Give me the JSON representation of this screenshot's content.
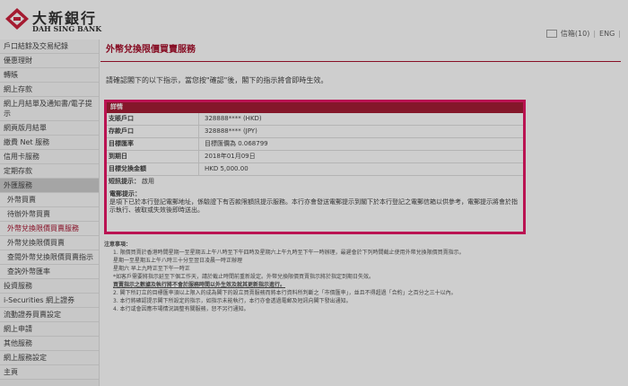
{
  "brand": {
    "name_cn": "大新銀行",
    "name_en": "DAH SING BANK"
  },
  "header": {
    "mail_label": "信箱(10)",
    "lang_en": "ENG"
  },
  "sidebar": {
    "items": [
      {
        "label": "戶口結餘及交易紀錄",
        "kind": "section"
      },
      {
        "label": "優惠理財",
        "kind": "section"
      },
      {
        "label": "轉賬",
        "kind": "section"
      },
      {
        "label": "網上存款",
        "kind": "section"
      },
      {
        "label": "網上月結單及通知書/電子提示",
        "kind": "section"
      },
      {
        "label": "網頁版月結單",
        "kind": "section"
      },
      {
        "label": "繳費 Net 服務",
        "kind": "section"
      },
      {
        "label": "信用卡服務",
        "kind": "section"
      },
      {
        "label": "定期存款",
        "kind": "section"
      },
      {
        "label": "外匯服務",
        "kind": "active"
      },
      {
        "label": "外幣買賣",
        "kind": "sub"
      },
      {
        "label": "待辦外幣買賣",
        "kind": "sub"
      },
      {
        "label": "外幣兌換限價買賣服務",
        "kind": "sub-hl"
      },
      {
        "label": "外幣兌換限價買賣",
        "kind": "sub"
      },
      {
        "label": "查閱外幣兌換限價買賣指示",
        "kind": "sub"
      },
      {
        "label": "查詢外幣匯率",
        "kind": "sub"
      },
      {
        "label": "投資服務",
        "kind": "section"
      },
      {
        "label": "i-Securities 網上證券",
        "kind": "section"
      },
      {
        "label": "流動證券買賣設定",
        "kind": "section"
      },
      {
        "label": "網上申請",
        "kind": "section"
      },
      {
        "label": "其他服務",
        "kind": "section"
      },
      {
        "label": "網上服務設定",
        "kind": "section"
      },
      {
        "label": "主頁",
        "kind": "section"
      }
    ]
  },
  "main": {
    "title": "外幣兌換限價買賣服務",
    "instruction": "請確認閣下的以下指示，當您按\"確認\"後，閣下的指示將會即時生效。",
    "confirm": {
      "heading": "詳情",
      "rows": [
        {
          "key": "支賬戶口",
          "value": "328888**** (HKD)"
        },
        {
          "key": "存款戶口",
          "value": "328888**** (JPY)"
        },
        {
          "key": "目標匯率",
          "value": "目標匯價為 0.068799"
        },
        {
          "key": "到期日",
          "value": "2018年01月09日"
        },
        {
          "key": "目標兌換金額",
          "value": "HKD 5,000.00"
        }
      ],
      "notice_label": "短訊提示：",
      "notice_value": "啟用",
      "email_label": "電郵提示：",
      "email_text": "是項下已於本行登記電郵地址，係驗證下有否款限額訊提示服務。本行亦會發送電郵提示到閣下於本行登記之電郵信箱以供參考，電郵提示將會於指示執行、被取或失效後即時送出。"
    },
    "notes": {
      "heading": "注意事項：",
      "lines": [
        "1.  限價買賣於香港時間星期一至星期五上午八時至下午四時及星期六上午九時至下午一時辦理，最遲會於下列時間截止使用外幣兌換限價買賣指示。",
        "星期一至星期五上午八時三十分至翌日凌晨一時正辦理",
        "星期六     早上九時正至下午一時正",
        "*如客戶需要將指示延至下個工作天，請於截止時間前重新設定。外幣兌換限價買賣指示將於指定到期日失效。",
        "買賣指示之數據及執行將不會於服務時間以外生效及就其更新指示進行。",
        "2.  閣下所訂立的目標匯率須以上限入的成為閣下的設立買賣服務而將本行資料所判斷之「市價匯率」，並且不得超過「合約」之百分之三十以內。",
        "3.  本行將確認提示閣下所設定的指示，如指示未能執行，本行亦會透過電郵及短訊向閣下發出通知。",
        "4.  本行或會因應市場情況調整有關服務，恕不另行通知。"
      ]
    }
  }
}
